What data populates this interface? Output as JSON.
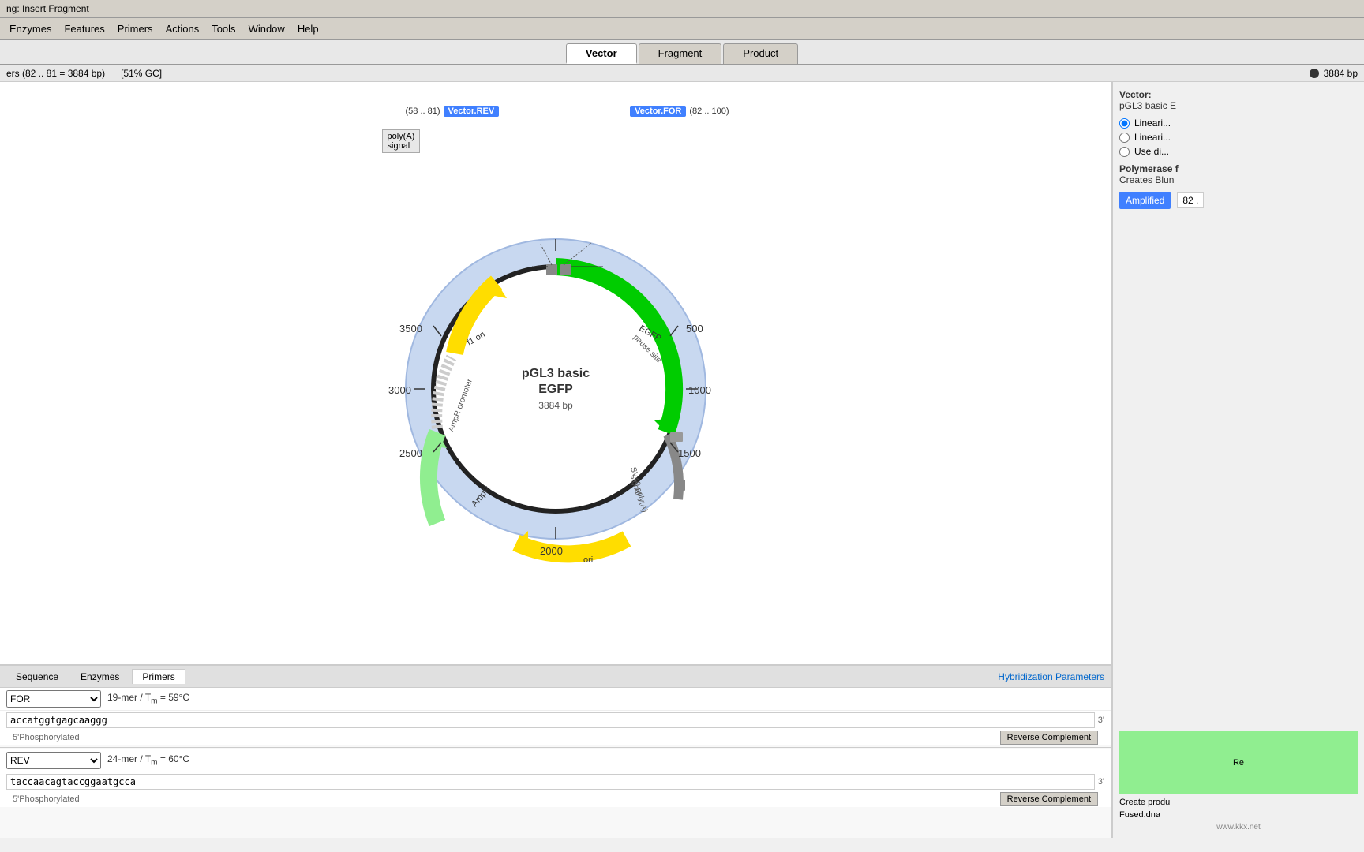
{
  "title": "ng: Insert Fragment",
  "menu": {
    "items": [
      "Enzymes",
      "Features",
      "Primers",
      "Actions",
      "Tools",
      "Window",
      "Help"
    ]
  },
  "tabs": {
    "items": [
      "Vector",
      "Fragment",
      "Product"
    ],
    "active": "Vector"
  },
  "infobar": {
    "primers_info": "ers (82 .. 81 = 3884 bp)",
    "gc_content": "[51% GC]",
    "bp_count": "3884 bp"
  },
  "plasmid": {
    "name": "pGL3 basic",
    "subtitle": "EGFP",
    "bp": "3884 bp",
    "features": [
      {
        "label": "EGFP",
        "color": "#00cc00",
        "type": "arc"
      },
      {
        "label": "SV40 poly(A) signal",
        "color": "#777",
        "type": "arc"
      },
      {
        "label": "AmpR",
        "color": "#90ee90",
        "type": "arc"
      },
      {
        "label": "AmpR promoter",
        "color": "#cccccc",
        "type": "arc"
      },
      {
        "label": "f1 ori",
        "color": "#ffff00",
        "type": "arc"
      },
      {
        "label": "ori",
        "color": "#ffee00",
        "type": "arc"
      },
      {
        "label": "pause site",
        "color": "#888888",
        "type": "marker"
      },
      {
        "label": "poly(A) signal",
        "color": "#888888",
        "type": "marker"
      }
    ],
    "markers": {
      "top_right": "500",
      "right": "1000",
      "bottom_right": "1500",
      "bottom": "2000",
      "bottom_left": "2500",
      "left": "3000",
      "top_left": "3500"
    },
    "primers": {
      "for_label": "Vector.FOR",
      "for_range": "(82 .. 100)",
      "rev_label": "Vector.REV",
      "rev_range": "(58 .. 81)"
    },
    "poly_signal": "poly(A) signal"
  },
  "bottom_panel": {
    "tabs": [
      "Sequence",
      "Enzymes",
      "Primers"
    ],
    "active_tab": "Primers",
    "hybridization_link": "Hybridization Parameters",
    "primer1": {
      "name": "FOR",
      "mer": "19-mer",
      "tm_label": "Tm",
      "tm_value": "59°C",
      "sequence": "accatggtgagcaaggg",
      "three_prime": "3'",
      "phospho": "5'Phosphorylated",
      "rev_comp_btn": "Reverse Complement"
    },
    "primer2": {
      "name": "REV",
      "mer": "24-mer",
      "tm_label": "Tm",
      "tm_value": "60°C",
      "sequence": "taccaacagtaccggaatgcca",
      "three_prime": "3'",
      "phospho": "5'Phosphorylated",
      "rev_comp_btn": "Reverse Complement"
    }
  },
  "right_panel": {
    "vector_label": "Vector:",
    "vector_value": "pGL3 basic E",
    "linearize_options": [
      {
        "label": "Lineari...",
        "id": "radio1"
      },
      {
        "label": "Lineari...",
        "id": "radio2"
      },
      {
        "label": "Use di...",
        "id": "radio3"
      }
    ],
    "polymerase_label": "Polymerase f",
    "polymerase_value": "Creates Blun",
    "amplified_btn": "Amplified",
    "amplified_value": "82 .",
    "re_label": "Re",
    "create_product_label": "Create produ",
    "fused_label": "Fused.dna",
    "watermark": "www.kkx.net"
  }
}
